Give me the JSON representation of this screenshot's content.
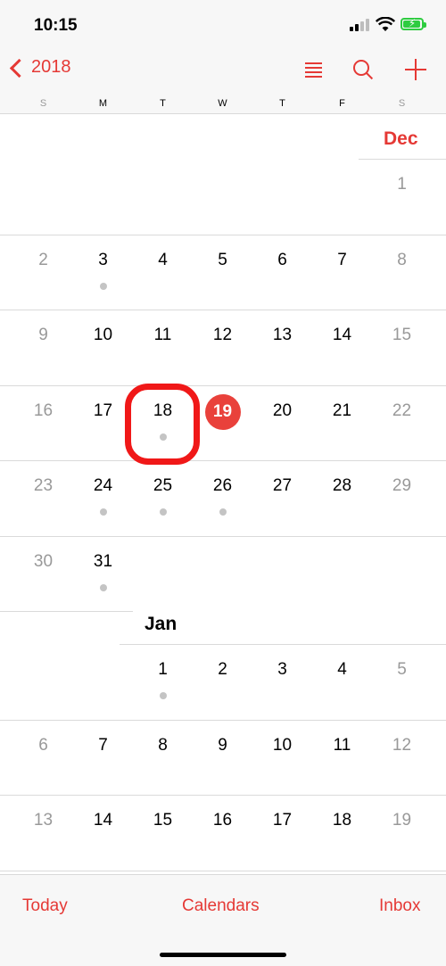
{
  "status_bar": {
    "time": "10:15"
  },
  "nav": {
    "back_label": "2018",
    "icons": [
      "list-view-icon",
      "search-icon",
      "add-icon"
    ]
  },
  "weekdays": [
    "S",
    "M",
    "T",
    "W",
    "T",
    "F",
    "S"
  ],
  "calendar": {
    "accent_color": "#e53935",
    "today": "19",
    "highlighted_day": "18",
    "months": [
      {
        "label": "Dec",
        "weeks": [
          [
            "",
            "",
            "",
            "",
            "",
            "",
            "1"
          ],
          [
            "2",
            "3",
            "4",
            "5",
            "6",
            "7",
            "8"
          ],
          [
            "9",
            "10",
            "11",
            "12",
            "13",
            "14",
            "15"
          ],
          [
            "16",
            "17",
            "18",
            "19",
            "20",
            "21",
            "22"
          ],
          [
            "23",
            "24",
            "25",
            "26",
            "27",
            "28",
            "29"
          ],
          [
            "30",
            "31",
            "",
            "",
            "",
            "",
            ""
          ]
        ],
        "event_days": [
          "3",
          "18",
          "24",
          "25",
          "26",
          "31"
        ]
      },
      {
        "label": "Jan",
        "weeks": [
          [
            "",
            "",
            "1",
            "2",
            "3",
            "4",
            "5"
          ],
          [
            "6",
            "7",
            "8",
            "9",
            "10",
            "11",
            "12"
          ],
          [
            "13",
            "14",
            "15",
            "16",
            "17",
            "18",
            "19"
          ]
        ],
        "event_days": [
          "1"
        ]
      }
    ]
  },
  "bottom_bar": {
    "today": "Today",
    "calendars": "Calendars",
    "inbox": "Inbox"
  }
}
